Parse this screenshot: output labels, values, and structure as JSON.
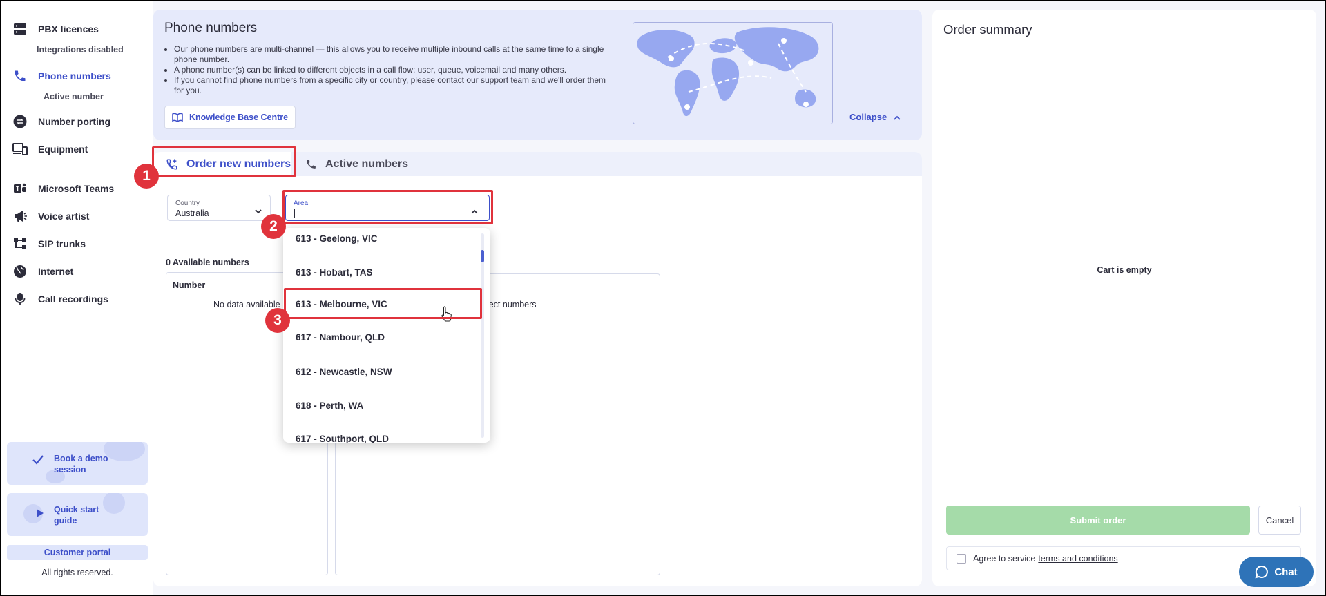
{
  "sidebar": {
    "items": [
      {
        "label": "PBX licences",
        "icon": "server-icon"
      },
      {
        "label": "Phone numbers",
        "icon": "phone-icon"
      },
      {
        "label": "Number porting",
        "icon": "swap-icon"
      },
      {
        "label": "Equipment",
        "icon": "devices-icon"
      },
      {
        "label": "Microsoft Teams",
        "icon": "teams-icon"
      },
      {
        "label": "Voice artist",
        "icon": "megaphone-icon"
      },
      {
        "label": "SIP trunks",
        "icon": "network-tree-icon"
      },
      {
        "label": "Internet",
        "icon": "globe-icon"
      },
      {
        "label": "Call recordings",
        "icon": "microphone-icon"
      }
    ],
    "pbx_sub": "Integrations disabled",
    "phone_sub": "Active number",
    "demo_label": "Book a demo session",
    "guide_label": "Quick start guide",
    "customer_portal": "Customer portal",
    "rights": "All rights reserved."
  },
  "banner": {
    "title": "Phone numbers",
    "bullets": [
      "Our phone numbers are multi-channel — this allows you to receive multiple inbound calls at the same time to a single phone number.",
      "A phone number(s) can be linked to different objects in a call flow: user, queue, voicemail and many others.",
      "If you cannot find phone numbers from a specific city or country, please contact our support team and we'll order them for you."
    ],
    "kb_button": "Knowledge Base Centre",
    "collapse": "Collapse"
  },
  "tabs": {
    "order_new": "Order new numbers",
    "active": "Active numbers"
  },
  "filters": {
    "country_label": "Country",
    "country_value": "Australia",
    "area_label": "Area",
    "area_value": ""
  },
  "table": {
    "available": "0 Available numbers",
    "number_header": "Number",
    "no_data": "No data available",
    "select_hint": "elect numbers"
  },
  "area_options": [
    "613 - Geelong, VIC",
    "613 - Hobart, TAS",
    "613 - Melbourne, VIC",
    "617 - Nambour, QLD",
    "612 - Newcastle, NSW",
    "618 - Perth, WA",
    "617 - Southport, QLD"
  ],
  "annotations": [
    "1",
    "2",
    "3"
  ],
  "order": {
    "title": "Order summary",
    "empty": "Cart is empty",
    "submit": "Submit order",
    "cancel": "Cancel",
    "agree": "Agree to service",
    "terms": "terms and conditions"
  },
  "chat": {
    "label": "Chat"
  },
  "colors": {
    "accent": "#3d4fc9",
    "annotation": "#e0333c",
    "submit": "#a5dba9",
    "chat": "#2e73b8"
  }
}
